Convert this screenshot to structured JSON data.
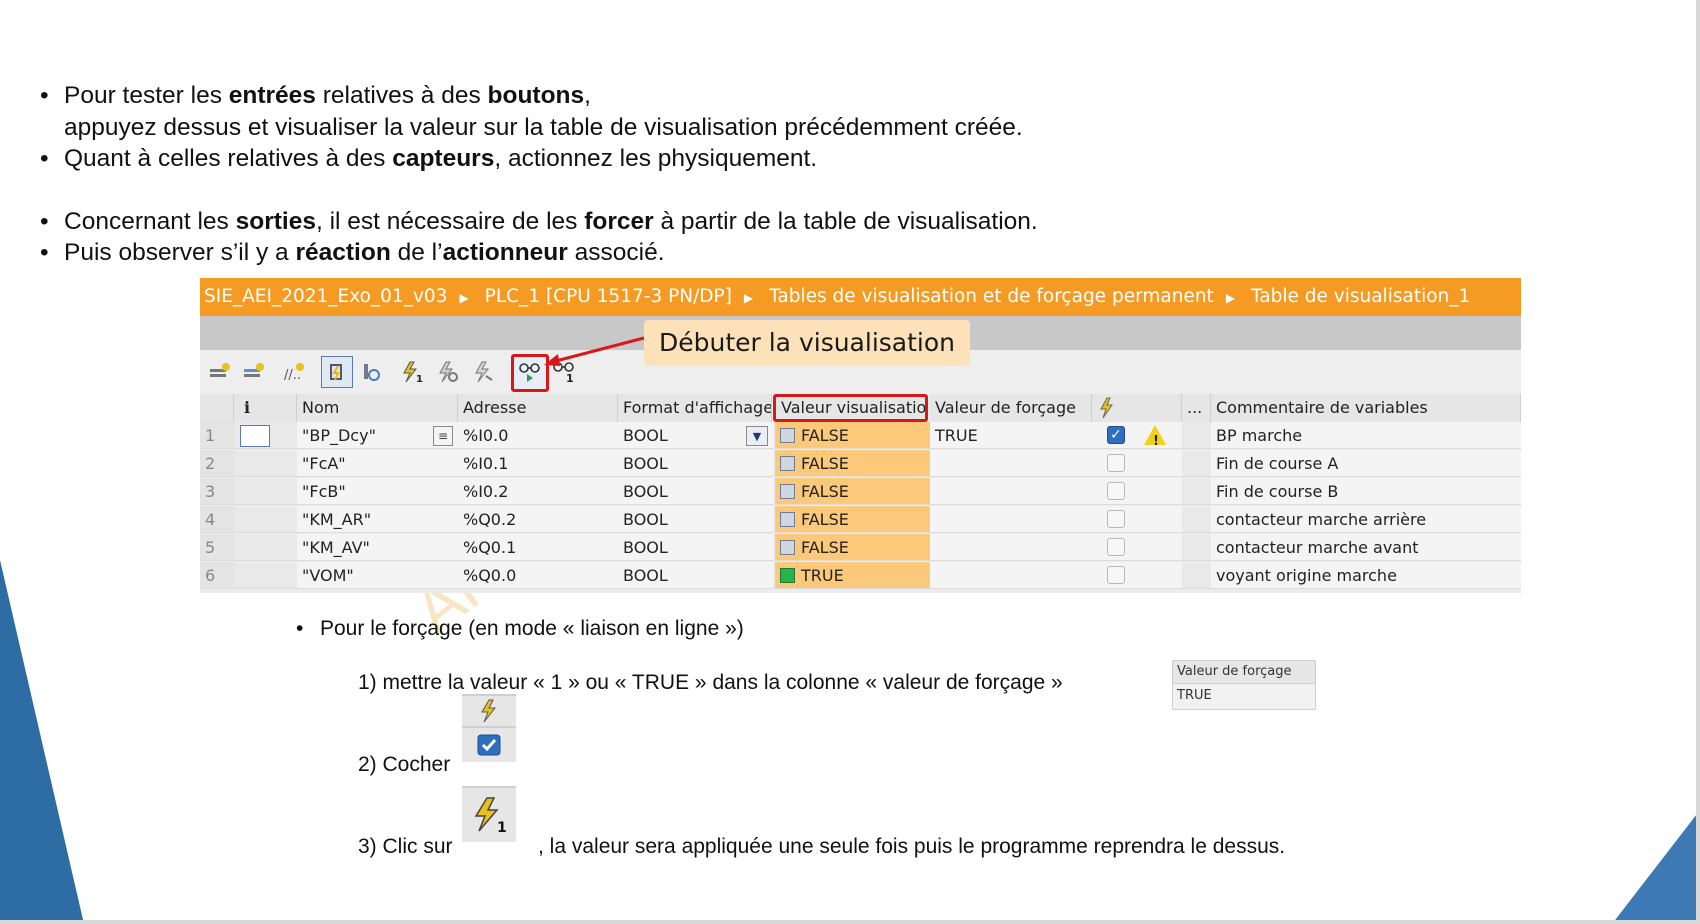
{
  "bullets": [
    {
      "parts": [
        {
          "t": "Pour tester les "
        },
        {
          "t": "entrées",
          "b": true
        },
        {
          "t": " relatives à des "
        },
        {
          "t": "boutons",
          "b": true
        },
        {
          "t": ","
        }
      ],
      "bullet": true
    },
    {
      "parts": [
        {
          "t": "appuyez dessus et visualiser la valeur sur la table de visualisation précédemment créée."
        }
      ],
      "bullet": false
    },
    {
      "parts": [
        {
          "t": "Quant à celles relatives à des "
        },
        {
          "t": "capteurs",
          "b": true
        },
        {
          "t": ", actionnez les physiquement."
        }
      ],
      "bullet": true
    },
    {
      "parts": [
        {
          "t": "Concernant les "
        },
        {
          "t": "sorties",
          "b": true
        },
        {
          "t": ", il est nécessaire de les "
        },
        {
          "t": "forcer",
          "b": true
        },
        {
          "t": " à partir de la table de visualisation."
        }
      ],
      "bullet": true
    },
    {
      "parts": [
        {
          "t": "Puis observer s’il y a "
        },
        {
          "t": "réaction",
          "b": true
        },
        {
          "t": " de l’"
        },
        {
          "t": "actionneur",
          "b": true
        },
        {
          "t": " associé."
        }
      ],
      "bullet": true
    }
  ],
  "tia": {
    "breadcrumb": [
      "SIE_AEI_2021_Exo_01_v03",
      "PLC_1 [CPU 1517-3 PN/DP]",
      "Tables de visualisation et de forçage permanent",
      "Table de visualisation_1"
    ],
    "callout": "Débuter la visualisation",
    "toolbar_icons": [
      "insert-row-icon",
      "add-row-icon",
      "dots-icon",
      "monitor-icon",
      "history-icon",
      "force-once-icon",
      "modify-icon",
      "force-all-icon",
      "monitor-all-icon",
      "monitor-once-icon"
    ],
    "columns": {
      "info": "i",
      "name": "Nom",
      "address": "Adresse",
      "format": "Format d'affichage",
      "monitor": "Valeur visualisatio",
      "force_value": "Valeur de forçage",
      "more": "...",
      "comment": "Commentaire de variables"
    },
    "rows": [
      {
        "idx": "1",
        "name": "\"BP_Dcy\"",
        "address": "%I0.0",
        "format": "BOOL",
        "value": "FALSE",
        "on": false,
        "force": "TRUE",
        "checked": true,
        "warn": true,
        "comment": "BP marche"
      },
      {
        "idx": "2",
        "name": "\"FcA\"",
        "address": "%I0.1",
        "format": "BOOL",
        "value": "FALSE",
        "on": false,
        "force": "",
        "checked": false,
        "warn": false,
        "comment": "Fin de course A"
      },
      {
        "idx": "3",
        "name": "\"FcB\"",
        "address": "%I0.2",
        "format": "BOOL",
        "value": "FALSE",
        "on": false,
        "force": "",
        "checked": false,
        "warn": false,
        "comment": "Fin de course B"
      },
      {
        "idx": "4",
        "name": "\"KM_AR\"",
        "address": "%Q0.2",
        "format": "BOOL",
        "value": "FALSE",
        "on": false,
        "force": "",
        "checked": false,
        "warn": false,
        "comment": "contacteur marche arrière"
      },
      {
        "idx": "5",
        "name": "\"KM_AV\"",
        "address": "%Q0.1",
        "format": "BOOL",
        "value": "FALSE",
        "on": false,
        "force": "",
        "checked": false,
        "warn": false,
        "comment": "contacteur marche avant"
      },
      {
        "idx": "6",
        "name": "\"VOM\"",
        "address": "%Q0.0",
        "format": "BOOL",
        "value": "TRUE",
        "on": true,
        "force": "",
        "checked": false,
        "warn": false,
        "comment": "voyant origine marche"
      }
    ]
  },
  "forcing": {
    "intro": "Pour le forçage (en mode « liaison en ligne »)",
    "step1": "1)  mettre la valeur « 1  » ou « TRUE » dans la colonne « valeur de forçage »",
    "step2": "2)  Cocher",
    "step3a": "3) Clic sur",
    "step3b": ", la valeur sera appliquée une seule fois puis le programme reprendra le dessus.",
    "mini_header": "Valeur de forçage",
    "mini_value": "TRUE"
  },
  "watermark": "AFFORM..."
}
